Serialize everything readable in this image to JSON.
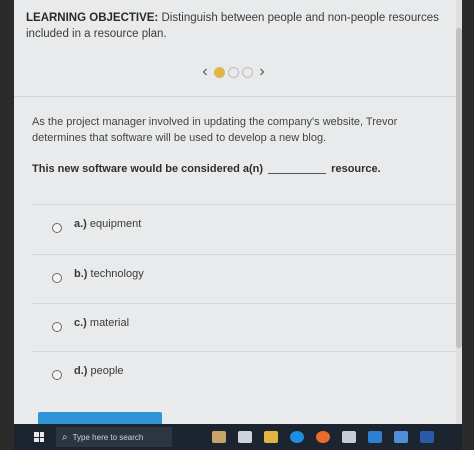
{
  "objective": {
    "heading": "LEARNING OBJECTIVE:",
    "text": "Distinguish between people and non-people resources included in a resource plan."
  },
  "pager": {
    "prev_icon": "chevron-left-icon",
    "next_icon": "chevron-right-icon",
    "total_dots": 3,
    "active_dot": 1
  },
  "question": {
    "scenario": "As the project manager involved in updating the company's website, Trevor determines that software will be used to develop a new blog.",
    "prompt_before": "This new software would be considered a(n)",
    "prompt_after": "resource."
  },
  "options": [
    {
      "key": "a.)",
      "text": "equipment"
    },
    {
      "key": "b.)",
      "text": "technology"
    },
    {
      "key": "c.)",
      "text": "material"
    },
    {
      "key": "d.)",
      "text": "people"
    }
  ],
  "taskbar": {
    "search_placeholder": "Type here to search"
  },
  "colors": {
    "active_dot": "#e0b648",
    "submit_button": "#2f95d6",
    "taskbar": "#1c2430"
  }
}
